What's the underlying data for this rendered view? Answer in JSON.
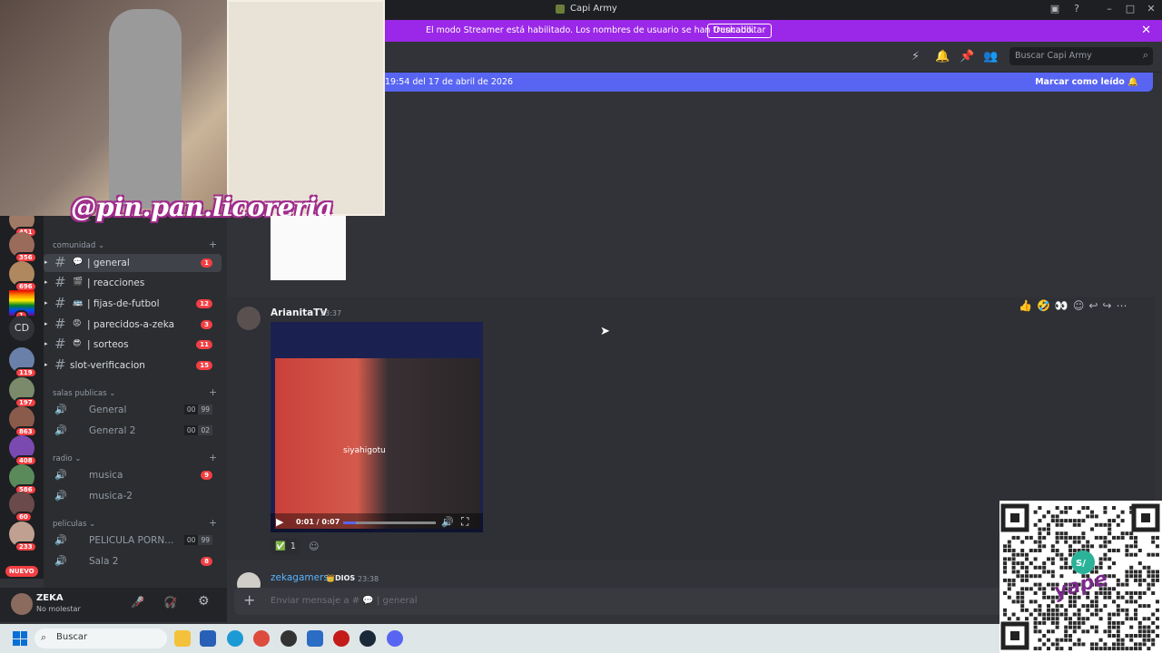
{
  "window": {
    "title": "Capi Army"
  },
  "banner": {
    "text": "El modo Streamer está habilitado. Los nombres de usuario se han truncado.",
    "button": "Deshabilitar"
  },
  "header": {
    "search_placeholder": "Buscar Capi Army"
  },
  "new_messages_bar": {
    "left": "19:54 del 17 de abril de 2026",
    "right": "Marcar como leído"
  },
  "overlay": {
    "watermark": "@pin.pan.licoreria"
  },
  "guilds": [
    {
      "badge": "451"
    },
    {
      "badge": "356"
    },
    {
      "badge": "696"
    },
    {
      "badge": "1"
    },
    {
      "label": "CD"
    },
    {
      "badge": "119"
    },
    {
      "badge": "197"
    },
    {
      "badge": "863"
    },
    {
      "badge": "408"
    },
    {
      "badge": "586"
    },
    {
      "badge": "60"
    },
    {
      "badge": "233"
    }
  ],
  "guild_nuevo": "NUEVO",
  "sidebar": {
    "categories": {
      "comunidad": "comunidad",
      "salas": "salas publicas",
      "radio": "radio",
      "peliculas": "peliculas"
    },
    "text_channels": [
      {
        "name": "| general",
        "icon": "💬",
        "count": "1"
      },
      {
        "name": "| reacciones",
        "icon": "🎬",
        "count": ""
      },
      {
        "name": "| fijas-de-futbol",
        "icon": "🚌",
        "count": "12"
      },
      {
        "name": "| parecidos-a-zeka",
        "icon": "😡",
        "count": "3"
      },
      {
        "name": "| sorteos",
        "icon": "😎",
        "count": "11"
      },
      {
        "name": "slot-verificacion",
        "icon": "",
        "count": "15"
      }
    ],
    "voice_salas": [
      {
        "name": "General",
        "a": "00",
        "b": "99"
      },
      {
        "name": "General 2",
        "a": "00",
        "b": "02"
      }
    ],
    "voice_radio": [
      {
        "name": "musica",
        "count": "9"
      },
      {
        "name": "musica-2",
        "count": ""
      }
    ],
    "voice_peliculas": [
      {
        "name": "PELICULA PORN...",
        "a": "00",
        "b": "99"
      },
      {
        "name": "Sala 2",
        "count": "8"
      }
    ]
  },
  "user": {
    "name": "ZEKA",
    "status": "No molestar"
  },
  "message": {
    "author": "ArianitaTV",
    "time": "23:37",
    "video_caption": "siyahigotu",
    "video_time": "0:01 / 0:07",
    "video_progress": 0.14,
    "reaction_emoji": "✅",
    "reaction_count": "1"
  },
  "message2": {
    "author": "zekagamers",
    "badge": "DIOS",
    "time": "23:38"
  },
  "composer": {
    "placeholder": "Enviar mensaje a # 💬 | general"
  },
  "taskbar": {
    "search": "Buscar"
  },
  "qr_label": "yape",
  "colors": {
    "accent": "#5865f2",
    "banner": "#9b27e8",
    "badge": "#f23f43"
  }
}
